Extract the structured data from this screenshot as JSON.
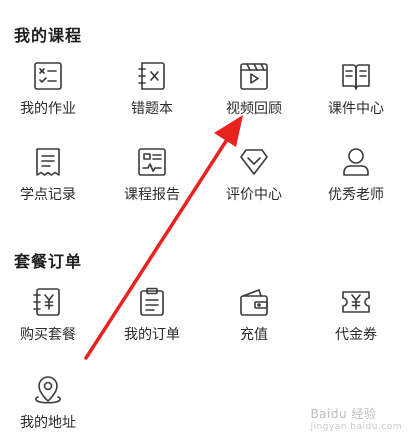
{
  "sections": {
    "courses": {
      "title": "我的课程",
      "items": [
        {
          "label": "我的作业",
          "icon": "homework-checklist-icon"
        },
        {
          "label": "错题本",
          "icon": "wrong-answers-notebook-icon"
        },
        {
          "label": "视频回顾",
          "icon": "video-playback-icon"
        },
        {
          "label": "课件中心",
          "icon": "courseware-book-icon"
        },
        {
          "label": "学点记录",
          "icon": "study-record-receipt-icon"
        },
        {
          "label": "课程报告",
          "icon": "course-report-icon"
        },
        {
          "label": "评价中心",
          "icon": "diamond-rating-icon"
        },
        {
          "label": "优秀老师",
          "icon": "teacher-person-icon"
        }
      ]
    },
    "orders": {
      "title": "套餐订单",
      "items": [
        {
          "label": "购买套餐",
          "icon": "buy-package-yen-icon"
        },
        {
          "label": "我的订单",
          "icon": "order-clipboard-icon"
        },
        {
          "label": "充值",
          "icon": "wallet-recharge-icon"
        },
        {
          "label": "代金券",
          "icon": "voucher-ticket-icon"
        },
        {
          "label": "我的地址",
          "icon": "location-pin-icon"
        }
      ]
    }
  },
  "watermark": {
    "text": "Baidu 经验",
    "sub": "jingyan.baidu.com"
  },
  "colors": {
    "arrow": "#e8231f",
    "icon": "#3a3a3a",
    "title": "#1e1e1e"
  }
}
